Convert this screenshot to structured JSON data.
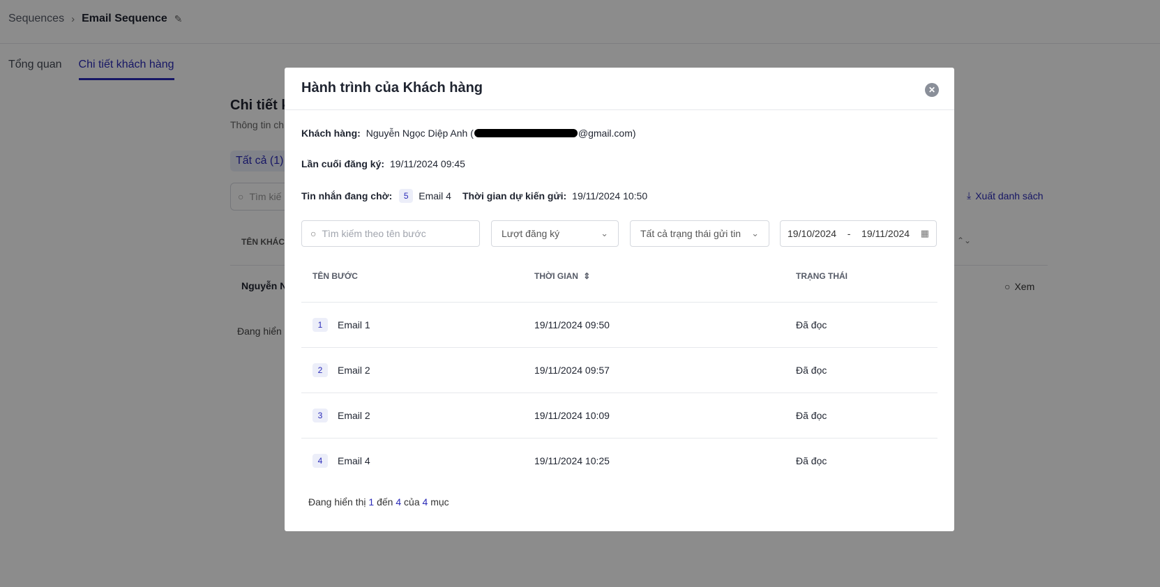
{
  "breadcrumb": {
    "root": "Sequences",
    "current": "Email Sequence"
  },
  "tabs": [
    {
      "label": "Tổng quan"
    },
    {
      "label": "Chi tiết khách hàng"
    }
  ],
  "section": {
    "title": "Chi tiết k",
    "subtitle": "Thông tin ch"
  },
  "chip": {
    "label": "Tất cả (1)"
  },
  "bg_search": {
    "placeholder": "Tìm kiế"
  },
  "export_label": "Xuất danh sách",
  "bg_table": {
    "header": "TÊN KHÁCH",
    "row_name": "Nguyễn N",
    "view_label": "Xem",
    "footer": "Đang hiển t"
  },
  "modal": {
    "title": "Hành trình của Khách hàng",
    "customer_label": "Khách hàng:",
    "customer_name": "Nguyễn Ngọc Diệp Anh (",
    "customer_email_suffix": "@gmail.com)",
    "last_signup_label": "Lần cuối đăng ký:",
    "last_signup_value": "19/11/2024 09:45",
    "pending_label": "Tin nhắn đang chờ:",
    "pending_count": "5",
    "pending_email": "Email 4",
    "scheduled_label": "Thời gian dự kiến gửi:",
    "scheduled_value": "19/11/2024 10:50",
    "search_placeholder": "Tìm kiếm theo tên bước",
    "filter_signup": "Lượt đăng ký",
    "filter_status": "Tất cả trạng thái gửi tin",
    "date_from": "19/10/2024",
    "date_sep": "-",
    "date_to": "19/11/2024",
    "columns": {
      "step": "TÊN BƯỚC",
      "time": "THỜI GIAN",
      "status": "TRẠNG THÁI"
    },
    "rows": [
      {
        "no": "1",
        "name": "Email 1",
        "time": "19/11/2024 09:50",
        "status": "Đã đọc"
      },
      {
        "no": "2",
        "name": "Email 2",
        "time": "19/11/2024 09:57",
        "status": "Đã đọc"
      },
      {
        "no": "3",
        "name": "Email 2",
        "time": "19/11/2024 10:09",
        "status": "Đã đọc"
      },
      {
        "no": "4",
        "name": "Email 4",
        "time": "19/11/2024 10:25",
        "status": "Đã đọc"
      }
    ],
    "footer": {
      "prefix": "Đang hiển thị",
      "from": "1",
      "to_word": "đến",
      "to": "4",
      "of_word": "của",
      "total": "4",
      "suffix": "mục"
    }
  },
  "colors": {
    "accent": "#2a2ab8",
    "overlay": "rgba(0,0,0,0.45)",
    "badge_bg": "#eceef9"
  }
}
